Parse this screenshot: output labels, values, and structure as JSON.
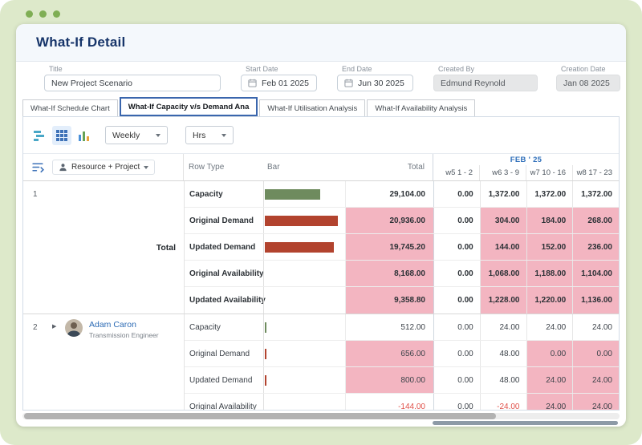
{
  "window": {
    "title": "What-If Detail"
  },
  "form": {
    "fields": [
      {
        "label": "Title",
        "value": "New Project Scenario",
        "type": "text"
      },
      {
        "label": "Start Date",
        "value": "Feb 01 2025",
        "type": "date"
      },
      {
        "label": "End Date",
        "value": "Jun 30 2025",
        "type": "date"
      },
      {
        "label": "Created By",
        "value": "Edmund Reynold",
        "type": "readonly"
      },
      {
        "label": "Creation Date",
        "value": "Jan 08 2025",
        "type": "readonly"
      }
    ]
  },
  "tabs": [
    {
      "label": "What-If Schedule Chart",
      "active": false
    },
    {
      "label": "What-If Capacity v/s Demand Ana",
      "active": true
    },
    {
      "label": "What-If Utilisation Analysis",
      "active": false
    },
    {
      "label": "What-If Availability Analysis",
      "active": false
    }
  ],
  "toolbar": {
    "period_value": "Weekly",
    "unit_value": "Hrs"
  },
  "grid": {
    "selector_label": "Resource + Project",
    "month_header": "FEB ' 25",
    "columns": {
      "row_type": "Row Type",
      "bar": "Bar",
      "total": "Total",
      "weeks": [
        "w5 1 - 2",
        "w6 3 - 9",
        "w7 10 - 16",
        "w8 17 - 23"
      ]
    },
    "colors": {
      "frame_green": "#dde9ca",
      "accent_navy": "#17356a",
      "link_blue": "#2e6cb5",
      "month_blue": "#2f6fba",
      "pink": "#f3b5c1",
      "capacity_bar": "#6e8b5e",
      "demand_bar": "#b2432e",
      "negative": "#e0514a"
    },
    "groups": [
      {
        "index": "1",
        "label": "Total",
        "bold": true,
        "rows": [
          {
            "type": "Capacity",
            "bar_color": "capacity",
            "bar_pct": 68,
            "total": {
              "v": "29,104.00"
            },
            "weeks": [
              {
                "v": "0.00"
              },
              {
                "v": "1,372.00"
              },
              {
                "v": "1,372.00"
              },
              {
                "v": "1,372.00"
              }
            ]
          },
          {
            "type": "Original Demand",
            "bar_color": "demand",
            "bar_pct": 90,
            "total": {
              "v": "20,936.00",
              "pink": true
            },
            "weeks": [
              {
                "v": "0.00"
              },
              {
                "v": "304.00",
                "pink": true
              },
              {
                "v": "184.00",
                "pink": true
              },
              {
                "v": "268.00",
                "pink": true
              }
            ]
          },
          {
            "type": "Updated Demand",
            "bar_color": "demand",
            "bar_pct": 85,
            "total": {
              "v": "19,745.20",
              "pink": true
            },
            "weeks": [
              {
                "v": "0.00"
              },
              {
                "v": "144.00",
                "pink": true
              },
              {
                "v": "152.00",
                "pink": true
              },
              {
                "v": "236.00",
                "pink": true
              }
            ]
          },
          {
            "type": "Original Availability",
            "bar_pct": 0,
            "total": {
              "v": "8,168.00",
              "pink": true
            },
            "weeks": [
              {
                "v": "0.00"
              },
              {
                "v": "1,068.00",
                "pink": true
              },
              {
                "v": "1,188.00",
                "pink": true
              },
              {
                "v": "1,104.00",
                "pink": true
              }
            ]
          },
          {
            "type": "Updated Availability",
            "bar_pct": 0,
            "total": {
              "v": "9,358.80",
              "pink": true
            },
            "weeks": [
              {
                "v": "0.00"
              },
              {
                "v": "1,228.00",
                "pink": true
              },
              {
                "v": "1,220.00",
                "pink": true
              },
              {
                "v": "1,136.00",
                "pink": true
              }
            ]
          }
        ]
      },
      {
        "index": "2",
        "name": "Adam Caron",
        "subtitle": "Transmission Engineer",
        "expandable": true,
        "bold": false,
        "rows": [
          {
            "type": "Capacity",
            "bar_color": "capacity",
            "bar_pct": 2,
            "total": {
              "v": "512.00"
            },
            "weeks": [
              {
                "v": "0.00"
              },
              {
                "v": "24.00"
              },
              {
                "v": "24.00"
              },
              {
                "v": "24.00"
              }
            ]
          },
          {
            "type": "Original Demand",
            "bar_color": "demand",
            "bar_pct": 2,
            "total": {
              "v": "656.00",
              "pink": true
            },
            "weeks": [
              {
                "v": "0.00"
              },
              {
                "v": "48.00"
              },
              {
                "v": "0.00",
                "pink": true
              },
              {
                "v": "0.00",
                "pink": true
              }
            ]
          },
          {
            "type": "Updated Demand",
            "bar_color": "demand",
            "bar_pct": 2,
            "total": {
              "v": "800.00",
              "pink": true
            },
            "weeks": [
              {
                "v": "0.00"
              },
              {
                "v": "48.00"
              },
              {
                "v": "24.00",
                "pink": true
              },
              {
                "v": "24.00",
                "pink": true
              }
            ]
          },
          {
            "type": "Original Availability",
            "bar_pct": 0,
            "total": {
              "v": "-144.00",
              "neg": true
            },
            "weeks": [
              {
                "v": "0.00"
              },
              {
                "v": "-24.00",
                "neg": true
              },
              {
                "v": "24.00",
                "pink": true
              },
              {
                "v": "24.00",
                "pink": true
              }
            ]
          }
        ]
      }
    ]
  }
}
